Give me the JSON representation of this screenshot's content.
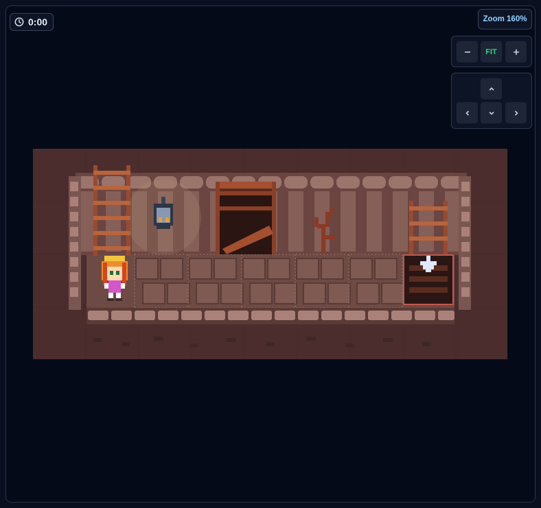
{
  "hud": {
    "timer": "0:00",
    "zoom_label": "Zoom 160%",
    "fit_label": "FIT"
  },
  "icons": {
    "timer": "clock-icon",
    "zoom_out": "minus-icon",
    "zoom_in": "plus-icon",
    "up": "chevron-up-icon",
    "left": "chevron-left-icon",
    "down": "chevron-down-icon",
    "right": "chevron-right-icon"
  },
  "colors": {
    "accent_zoom": "#8fd3ff",
    "accent_fit": "#34d28a",
    "background": "#050a19",
    "floor": "#6e4a44",
    "wall": "#4a2c2c",
    "goal_outline": "#c0584a"
  }
}
